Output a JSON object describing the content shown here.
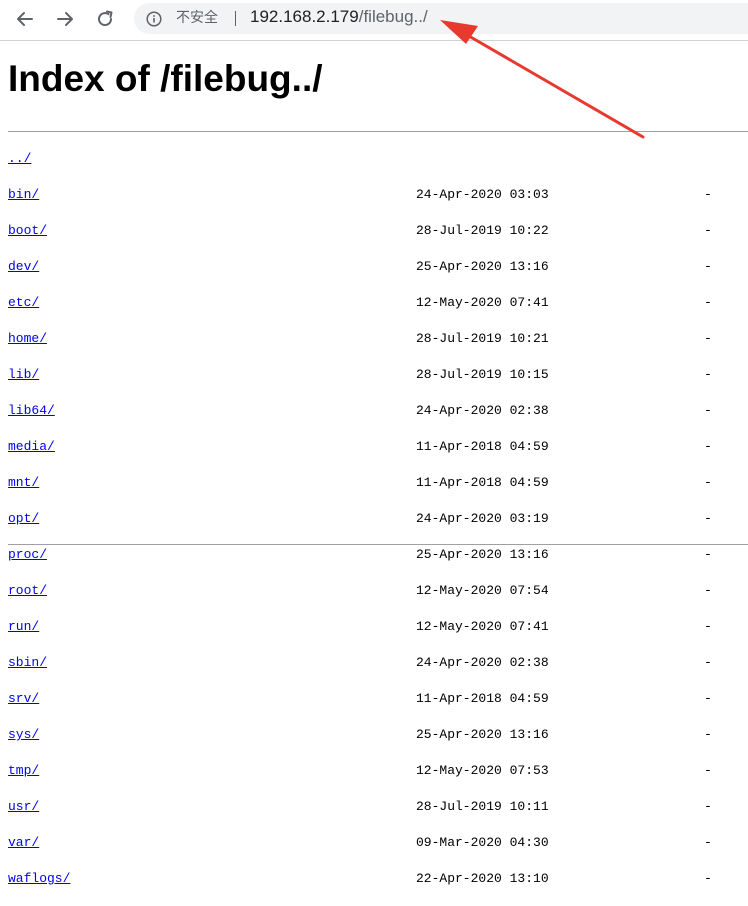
{
  "browser": {
    "security_label": "不安全",
    "url_host": "192.168.2.179",
    "url_path": "/filebug../"
  },
  "page": {
    "title": "Index of /filebug../"
  },
  "parent_link": "../",
  "entries": [
    {
      "name": "bin/",
      "date": "24-Apr-2020 03:03",
      "size": "-"
    },
    {
      "name": "boot/",
      "date": "28-Jul-2019 10:22",
      "size": "-"
    },
    {
      "name": "dev/",
      "date": "25-Apr-2020 13:16",
      "size": "-"
    },
    {
      "name": "etc/",
      "date": "12-May-2020 07:41",
      "size": "-"
    },
    {
      "name": "home/",
      "date": "28-Jul-2019 10:21",
      "size": "-"
    },
    {
      "name": "lib/",
      "date": "28-Jul-2019 10:15",
      "size": "-"
    },
    {
      "name": "lib64/",
      "date": "24-Apr-2020 02:38",
      "size": "-"
    },
    {
      "name": "media/",
      "date": "11-Apr-2018 04:59",
      "size": "-"
    },
    {
      "name": "mnt/",
      "date": "11-Apr-2018 04:59",
      "size": "-"
    },
    {
      "name": "opt/",
      "date": "24-Apr-2020 03:19",
      "size": "-"
    },
    {
      "name": "proc/",
      "date": "25-Apr-2020 13:16",
      "size": "-"
    },
    {
      "name": "root/",
      "date": "12-May-2020 07:54",
      "size": "-"
    },
    {
      "name": "run/",
      "date": "12-May-2020 07:41",
      "size": "-"
    },
    {
      "name": "sbin/",
      "date": "24-Apr-2020 02:38",
      "size": "-"
    },
    {
      "name": "srv/",
      "date": "11-Apr-2018 04:59",
      "size": "-"
    },
    {
      "name": "sys/",
      "date": "25-Apr-2020 13:16",
      "size": "-"
    },
    {
      "name": "tmp/",
      "date": "12-May-2020 07:53",
      "size": "-"
    },
    {
      "name": "usr/",
      "date": "28-Jul-2019 10:11",
      "size": "-"
    },
    {
      "name": "var/",
      "date": "09-Mar-2020 04:30",
      "size": "-"
    },
    {
      "name": "waflogs/",
      "date": "22-Apr-2020 13:10",
      "size": "-"
    }
  ],
  "colors": {
    "link": "#0000ee",
    "annotation_arrow": "#e8392f",
    "address_bar": "#f1f3f4"
  }
}
